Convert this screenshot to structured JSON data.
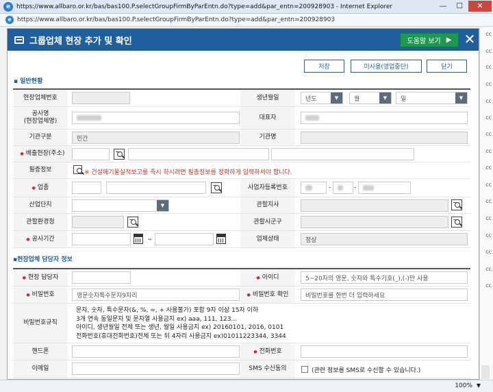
{
  "window": {
    "title": "https://www.allbaro.or.kr/bas/bas100.P.selectGroupFirmByParEntn.do?type=add&par_entn=200928903 - Internet Explorer",
    "url": "https://www.allbaro.or.kr/bas/bas100.P.selectGroupFirmByParEntn.do?type=add&par_entn=200928903",
    "minimize": "—",
    "maximize": "☐",
    "close": "✕"
  },
  "dialog": {
    "title": "그룹업체 현장 추가 및 확인",
    "help_button": "도움말 보기",
    "help_pin": "▶",
    "close": "✕"
  },
  "toolbar": {
    "save": "저장",
    "unused": "미사용(영업중단)",
    "close": "닫기"
  },
  "section1": {
    "title": "일반현황",
    "fields": {
      "site_code_label": "현장업체번호",
      "birth_label": "생년월일",
      "year_select": "년도",
      "month_select": "월",
      "day_select": "일",
      "project_name_label": "공사명\n(현장업체명)",
      "ceo_label": "대표자",
      "org_type_label": "기관구분",
      "org_type_value": "민간",
      "org_name_label": "기관명",
      "discharge_site_label": "배출현장(주소)",
      "auth_info_label": "필증정보",
      "auth_warning": "※ 건설폐기물실적보고를 즉시 하시려면 필증정보를 정확하게 입력하셔야 합니다.",
      "business_type_label": "업종",
      "biz_reg_label": "사업자등록번호",
      "biz_reg_sep1": "-",
      "biz_reg_sep2": "-",
      "industrial_complex_label": "산업단지",
      "regional_office_label": "관할지사",
      "env_office_label": "관할환경청",
      "city_label": "관할시군구",
      "period_label": "공사기간",
      "period_sep": "~",
      "status_label": "업체상태",
      "status_value": "정상"
    }
  },
  "section2": {
    "title": "현장업체 담당자 정보",
    "fields": {
      "manager_label": "현장 담당자",
      "id_label": "아이디",
      "id_placeholder": "5~20자의 영문, 숫자와 특수기호(_),(-)만 사용",
      "password_label": "비밀번호",
      "password_placeholder": "영문숫자특수문자9자리",
      "password_confirm_label": "비밀번호 확인",
      "password_confirm_placeholder": "비밀번호를 한번 더 입력하세요",
      "password_rules_label": "비밀번호규칙",
      "password_rules": [
        "문자, 숫자, 특수문자(&, %, =, + 사용불가) 포함 9자 이상 15자 이하",
        "3개 연속 동일문자 및 문자열 사용금지 ex) aaa, 111, 123...",
        "아이디, 생년월일 전체 또는 생년, 월일 사용금지 ex) 20160101, 2016, 0101",
        "전화번호(휴대전화번호)전체 또는 뒤 4자리 사용금지 ex)01011223344, 3344"
      ],
      "mobile_label": "핸드폰",
      "phone_label": "전화번호",
      "email_label": "이메일",
      "sms_label": "SMS 수신동의",
      "sms_text": "(관련 정보를 SMS로 수신할 수 있습니다.)"
    }
  },
  "background_right": [
    "cc",
    "cc",
    "cc",
    "cc",
    "cc",
    "cc",
    "cc",
    "cc",
    "cc",
    "cc",
    "cc",
    "cc",
    "cc",
    "cc",
    "cc",
    "cc"
  ],
  "statusbar": {
    "zoom": "100%",
    "zoom_arrow": "▼"
  }
}
